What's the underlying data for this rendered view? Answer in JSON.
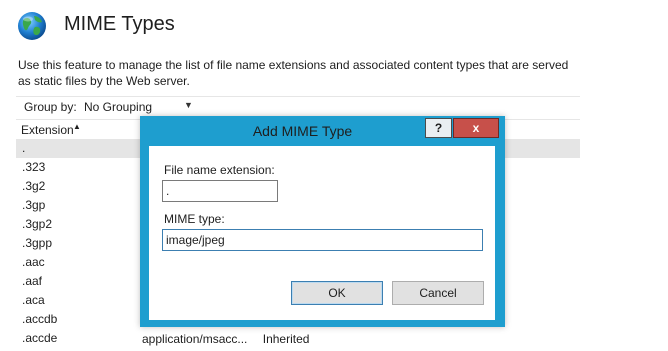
{
  "page": {
    "title": "MIME Types",
    "description": "Use this feature to manage the list of file name extensions and associated content types that are served as static files by the Web server."
  },
  "toolbar": {
    "group_label": "Group by:",
    "group_value": "No Grouping"
  },
  "list": {
    "column_extension": "Extension",
    "rows": [
      ".",
      ".323",
      ".3g2",
      ".3gp",
      ".3gp2",
      ".3gpp",
      ".aac",
      ".aaf",
      ".aca",
      ".accdb",
      ".accde"
    ],
    "bottom_row_cells": [
      "application/msacc...",
      "Inherited"
    ]
  },
  "dialog": {
    "title": "Add MIME Type",
    "help_label": "?",
    "close_label": "x",
    "ext_label": "File name extension:",
    "ext_value": ".",
    "mime_label": "MIME type:",
    "mime_value": "image/jpeg",
    "ok_label": "OK",
    "cancel_label": "Cancel"
  },
  "colors": {
    "dialog_frame": "#1e9ecf",
    "close_button": "#c7504a"
  },
  "icons": {
    "page_icon": "globe-icon",
    "sort": "sort-ascending-icon",
    "dropdown": "chevron-down-icon"
  }
}
